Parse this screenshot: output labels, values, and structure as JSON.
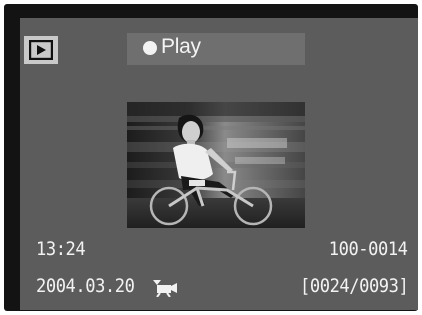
{
  "screen": {
    "mode_icon": "playback-mode-icon",
    "header": {
      "label": "Play",
      "indicator_icon": "recording-dot-icon"
    },
    "thumbnail_icon": "image-thumbnail",
    "info": {
      "time": "13:24",
      "file_number": "100-0014",
      "date": "2004.03.20",
      "date_icon": "movie-camera-icon",
      "frame_counter": "[0024/0093]"
    }
  },
  "colors": {
    "bezel": "#131313",
    "screen_bg": "#5c5c5c",
    "header_bg": "#6f6f6f",
    "mode_box_bg": "#c9c9c9",
    "text": "#f2f2f2"
  }
}
